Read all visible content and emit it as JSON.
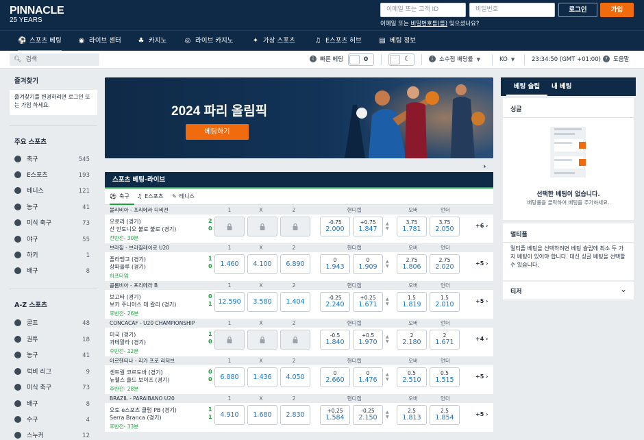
{
  "brand": {
    "name": "PINNACLE",
    "tagline": "25 YEARS"
  },
  "auth": {
    "email_placeholder": "이메일 또는 고객 ID",
    "password_placeholder": "비밀번호",
    "login_label": "로그인",
    "join_label": "가입",
    "forgot_prefix": "이메일 또는 ",
    "forgot_link": "비밀번호를(를)",
    "forgot_suffix": " 잊으셨나요?"
  },
  "nav": [
    {
      "label": "스포츠 베팅",
      "icon": "soccer-ball-icon",
      "glyph": "⚽"
    },
    {
      "label": "라이브 센터",
      "icon": "live-center-icon",
      "glyph": "◉"
    },
    {
      "label": "카지노",
      "icon": "casino-icon",
      "glyph": "♣"
    },
    {
      "label": "라이브 카지노",
      "icon": "roulette-icon",
      "glyph": "◎"
    },
    {
      "label": "가상 스포츠",
      "icon": "virtual-sports-icon",
      "glyph": "✦"
    },
    {
      "label": "E스포츠 허브",
      "icon": "headset-icon",
      "glyph": "♫"
    },
    {
      "label": "베팅 정보",
      "icon": "document-icon",
      "glyph": "▤"
    }
  ],
  "toolbar": {
    "search_label": "검색",
    "quick_bet_label": "빠른 베팅",
    "quick_bet_value": "0",
    "odds_format_label": "소수점 배당률",
    "language_label": "KO",
    "clock": "23:34:50 (GMT +01:00)",
    "help_label": "도움말"
  },
  "sidebar": {
    "favorites_title": "즐겨찾기",
    "favorites_note": "즐겨찾기를 변경하려면 로그인 또는 가입 하세요.",
    "main_title": "주요 스포츠",
    "main_sports": [
      {
        "name": "축구",
        "count": "545"
      },
      {
        "name": "E스포츠",
        "count": "193"
      },
      {
        "name": "테니스",
        "count": "121"
      },
      {
        "name": "농구",
        "count": "41"
      },
      {
        "name": "미식 축구",
        "count": "73"
      },
      {
        "name": "야구",
        "count": "55"
      },
      {
        "name": "하키",
        "count": "1"
      },
      {
        "name": "배구",
        "count": "8"
      }
    ],
    "az_title": "A-Z 스포츠",
    "az_sports": [
      {
        "name": "골프",
        "count": "48"
      },
      {
        "name": "권투",
        "count": "18"
      },
      {
        "name": "농구",
        "count": "41"
      },
      {
        "name": "럭비 리그",
        "count": "9"
      },
      {
        "name": "미식 축구",
        "count": "73"
      },
      {
        "name": "배구",
        "count": "8"
      },
      {
        "name": "수구",
        "count": "4"
      },
      {
        "name": "스누커",
        "count": "12"
      }
    ]
  },
  "banner": {
    "title": "2024 파리 올림픽",
    "button": "베팅하기"
  },
  "live": {
    "title": "스포츠 베팅-라이브",
    "tabs": [
      "축구",
      "E스포츠",
      "테니스"
    ],
    "col_labels": {
      "one": "1",
      "x": "X",
      "two": "2",
      "handicap": "핸디캡",
      "over": "오버",
      "under": "언더"
    },
    "matches": [
      {
        "league": "볼리비아 - 프리메라 디비젼",
        "home": "오로라 (경기)",
        "away": "산 안토니오 불로 불로 (경기)",
        "score_home": "2",
        "score_away": "0",
        "status": "전반전- 30분",
        "locked": true,
        "o1": "",
        "ox": "",
        "o2": "",
        "hcp_home_line": "-0.75",
        "hcp_home": "2.000",
        "hcp_away_line": "+0.75",
        "hcp_away": "1.847",
        "over_line": "3.75",
        "over": "1.781",
        "under_line": "3.75",
        "under": "2.050",
        "more": "+6"
      },
      {
        "league": "브라질 - 브라질레이로 U20",
        "home": "플라멩고 (경기)",
        "away": "상파울루 (경기)",
        "score_home": "1",
        "score_away": "0",
        "status": "하프타임",
        "locked": false,
        "o1": "1.460",
        "ox": "4.100",
        "o2": "6.890",
        "hcp_home_line": "0",
        "hcp_home": "1.943",
        "hcp_away_line": "0",
        "hcp_away": "1.909",
        "over_line": "2.75",
        "over": "1.806",
        "under_line": "2.75",
        "under": "2.020",
        "more": "+5"
      },
      {
        "league": "콜롬비아 - 프리메라 B",
        "home": "보고타 (경기)",
        "away": "보카 주니어스 데 칼리 (경기)",
        "score_home": "0",
        "score_away": "1",
        "status": "후반전- 26분",
        "locked": false,
        "o1": "12.590",
        "ox": "3.580",
        "o2": "1.404",
        "hcp_home_line": "-0.25",
        "hcp_home": "2.240",
        "hcp_away_line": "+0.25",
        "hcp_away": "1.671",
        "over_line": "1.5",
        "over": "1.819",
        "under_line": "1.5",
        "under": "2.010",
        "more": "+5"
      },
      {
        "league": "CONCACAF - U20 CHAMPIONSHIP",
        "home": "미국 (경기)",
        "away": "과테말라 (경기)",
        "score_home": "1",
        "score_away": "0",
        "status": "후반전- 22분",
        "locked": true,
        "o1": "",
        "ox": "",
        "o2": "",
        "hcp_home_line": "-0.5",
        "hcp_home": "1.840",
        "hcp_away_line": "+0.5",
        "hcp_away": "1.970",
        "over_line": "2",
        "over": "2.180",
        "under_line": "2",
        "under": "1.671",
        "more": "+4"
      },
      {
        "league": "아르헨티나 - 리가 프로 리저브",
        "home": "센트럴 코르도바 (경기)",
        "away": "뉴웰스 올드 보이즈 (경기)",
        "score_home": "0",
        "score_away": "0",
        "status": "후반전- 28분",
        "locked": false,
        "o1": "6.880",
        "ox": "1.436",
        "o2": "4.050",
        "hcp_home_line": "0",
        "hcp_home": "2.660",
        "hcp_away_line": "0",
        "hcp_away": "1.476",
        "over_line": "0.5",
        "over": "2.510",
        "under_line": "0.5",
        "under": "1.515",
        "more": "+5"
      },
      {
        "league": "BRAZIL - PARAIBANO U20",
        "home": "오토 e스포츠 클럽 PB (경기)",
        "away": "Serra Branca (경기)",
        "score_home": "1",
        "score_away": "1",
        "status": "후반전- 33분",
        "locked": false,
        "o1": "4.910",
        "ox": "1.680",
        "o2": "2.830",
        "hcp_home_line": "+0.25",
        "hcp_home": "1.584",
        "hcp_away_line": "-0.25",
        "hcp_away": "2.150",
        "over_line": "2.5",
        "over": "1.813",
        "under_line": "2.5",
        "under": "1.854",
        "more": "+5"
      }
    ]
  },
  "betslip": {
    "tab_slip": "베팅 슬립",
    "tab_mybets": "내 베팅",
    "single_title": "싱글",
    "empty_title": "선택한 베팅이 없습니다.",
    "empty_sub": "배당률을 클릭하여 베팅을 추가하세요.",
    "multi_title": "멀티플",
    "multi_text": "멀티플 베팅을 선택하려면 베팅 슬립에 최소 두 가지 베팅이 있어야 합니다. 대신 싱글 베팅을 선택할 수 있습니다.",
    "teaser_title": "티저"
  },
  "colors": {
    "navy": "#0f2a47",
    "accent": "#f06a0e",
    "live_green": "#17a53a",
    "odds_blue": "#1474c8"
  }
}
